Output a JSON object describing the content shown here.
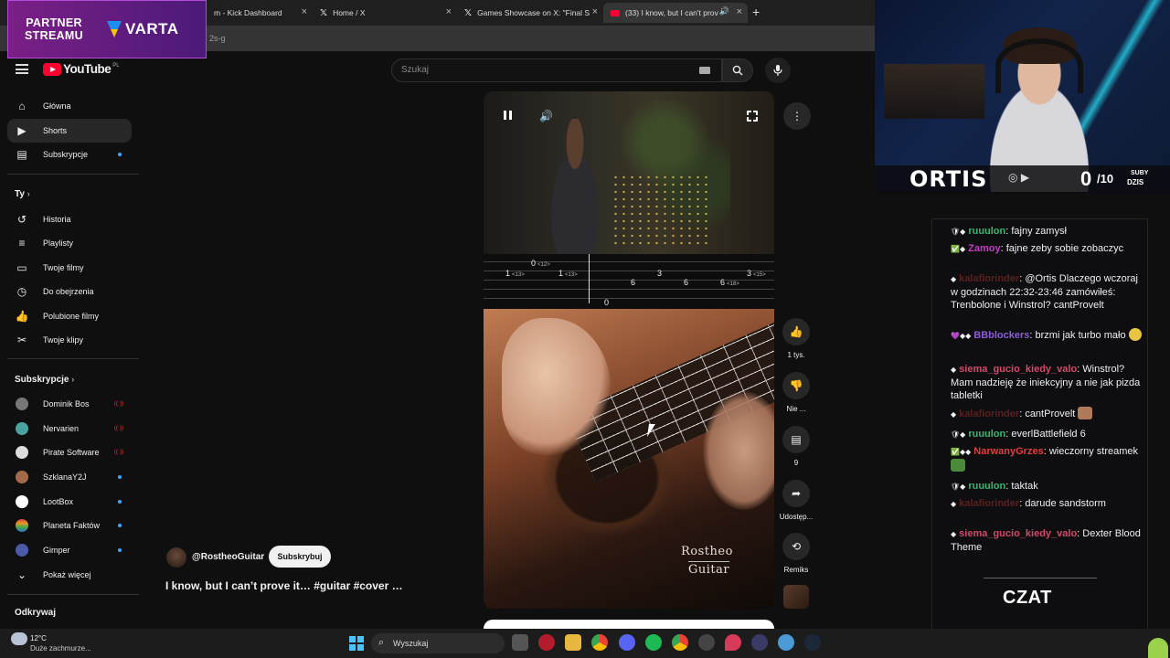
{
  "browser": {
    "tabs": [
      {
        "label": "m - Kick Dashboard",
        "icon": "kick-icon",
        "active": false
      },
      {
        "label": "Home / X",
        "icon": "x-logo-icon",
        "active": false
      },
      {
        "label": "Games Showcase on X: \"Final S",
        "icon": "x-logo-icon",
        "active": false
      },
      {
        "label": "(33) I know, but I can't prov",
        "icon": "youtube-icon",
        "active": true
      }
    ],
    "address_fragment": "2s-g",
    "new_tab": "+"
  },
  "partner": {
    "line1": "PARTNER",
    "line2": "STREAMU",
    "brand": "VARTA"
  },
  "youtube": {
    "logo_text": "YouTube",
    "region": "PL",
    "search_placeholder": "Szukaj",
    "nav": [
      {
        "label": "Główna",
        "icon": "home-icon"
      },
      {
        "label": "Shorts",
        "icon": "shorts-icon",
        "active": true
      },
      {
        "label": "Subskrypcje",
        "icon": "subscriptions-icon",
        "badge": "dot"
      }
    ],
    "you_section": "Ty",
    "you_items": [
      {
        "label": "Historia",
        "icon": "history-icon"
      },
      {
        "label": "Playlisty",
        "icon": "playlist-icon"
      },
      {
        "label": "Twoje filmy",
        "icon": "your-videos-icon"
      },
      {
        "label": "Do obejrzenia",
        "icon": "watch-later-icon"
      },
      {
        "label": "Polubione filmy",
        "icon": "like-icon"
      },
      {
        "label": "Twoje klipy",
        "icon": "clips-icon"
      }
    ],
    "subs_section": "Subskrypcje",
    "subscriptions": [
      {
        "label": "Dominik Bos",
        "status": "live",
        "color": "#777777"
      },
      {
        "label": "Nervarien",
        "status": "live",
        "color": "#4aa3a0"
      },
      {
        "label": "Pirate Software",
        "status": "live",
        "color": "#eeeeee"
      },
      {
        "label": "SzklanaY2J",
        "status": "dot",
        "color": "#a56a4a"
      },
      {
        "label": "LootBox",
        "status": "dot",
        "color": "#ffffff"
      },
      {
        "label": "Planeta Faktów",
        "status": "dot",
        "color": "#e29a2a"
      },
      {
        "label": "Gimper",
        "status": "dot",
        "color": "#4a5aa8"
      }
    ],
    "show_more": "Pokaż więcej",
    "explore_section": "Odkrywaj",
    "short": {
      "channel": "@RostheoGuitar",
      "subscribe_label": "Subskrybuj",
      "title": "I know, but I can’t prove it… #guitar #cover …",
      "watermark_line1": "Rostheo",
      "watermark_line2": "Guitar",
      "tab_top": {
        "fret": "0",
        "hint": "<12>"
      },
      "tab_row1": [
        {
          "fret": "1",
          "hint": "<13>"
        },
        {
          "fret": "1",
          "hint": "<13>"
        },
        {
          "fret": "3",
          "hint": ""
        },
        {
          "fret": "3",
          "hint": "<15>"
        }
      ],
      "tab_row2": [
        {
          "fret": "6",
          "hint": ""
        },
        {
          "fret": "6",
          "hint": ""
        },
        {
          "fret": "6",
          "hint": "<18>"
        }
      ],
      "tab_bottom": "0"
    },
    "actions": [
      {
        "label": "1 tys.",
        "icon": "thumbs-up-icon"
      },
      {
        "label": "Nie ...",
        "icon": "thumbs-down-icon"
      },
      {
        "label": "9",
        "icon": "comment-icon"
      },
      {
        "label": "Udostęp...",
        "icon": "share-icon"
      },
      {
        "label": "Remiks",
        "icon": "remix-icon"
      }
    ]
  },
  "stream": {
    "streamer": "ORTIS",
    "sub_count": "0",
    "sub_goal": "/10",
    "sub_label_1": "SUBY",
    "sub_label_2": "DZIS",
    "chat_logo": "CZAT",
    "chat": [
      {
        "user": "ruuulon",
        "color": "#3cb371",
        "text": "fajny zamysł"
      },
      {
        "user": "Zamoy",
        "color": "#c040c0",
        "text": "fajne zeby sobie zobaczyc"
      },
      {
        "user": "kalafiorinder",
        "color": "#5a2020",
        "text": "@Ortis Dlaczego wczoraj w godzinach 22:32-23:46 zamówiłeś: Trenbolone i Winstrol? cantProvelt"
      },
      {
        "user": "BBblockers",
        "color": "#8a5cd8",
        "text": "brzmi jak turbo mało"
      },
      {
        "user": "siema_gucio_kiedy_valo",
        "color": "#d14a6a",
        "text": "Winstrol? Mam nadzieję że iniekcyjny a nie jak pizda tabletki"
      },
      {
        "user": "kalafiorinder",
        "color": "#5a2020",
        "text": "cantProvelt"
      },
      {
        "user": "ruuulon",
        "color": "#3cb371",
        "text": "everlBattlefield 6"
      },
      {
        "user": "NarwanyGrzes",
        "color": "#e23d3d",
        "text": "wieczorny streamek"
      },
      {
        "user": "ruuulon",
        "color": "#3cb371",
        "text": "taktak"
      },
      {
        "user": "kalafiorinder",
        "color": "#5a2020",
        "text": "darude sandstorm"
      },
      {
        "user": "siema_gucio_kiedy_valo",
        "color": "#d14a6a",
        "text": "Dexter Blood Theme"
      }
    ]
  },
  "taskbar": {
    "weather_temp": "12°C",
    "weather_desc": "Duże zachmurze...",
    "search_label": "Wyszukaj"
  }
}
